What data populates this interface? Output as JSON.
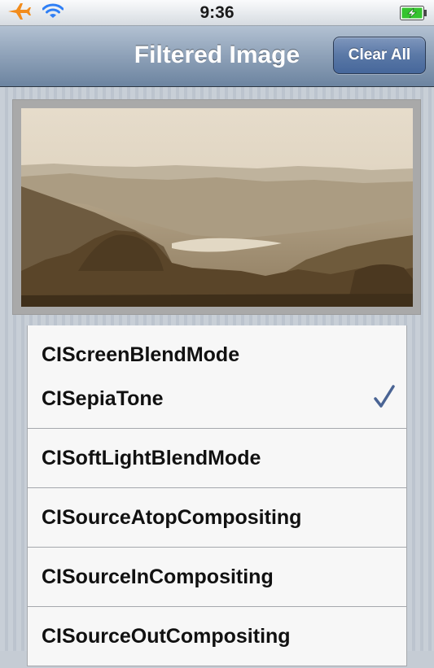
{
  "status_bar": {
    "time": "9:36",
    "icons": [
      "airplane-icon",
      "wifi-icon",
      "battery-charging-icon"
    ],
    "airplane_color": "#f28c1c",
    "wifi_color": "#2f7ff5",
    "battery_color": "#35c42f"
  },
  "nav": {
    "title": "Filtered Image",
    "clear_button": "Clear All"
  },
  "image": {
    "filter_applied": "CISepiaTone"
  },
  "filters": [
    {
      "label": "CIScreenBlendMode",
      "selected": false
    },
    {
      "label": "CISepiaTone",
      "selected": true
    },
    {
      "label": "CISoftLightBlendMode",
      "selected": false
    },
    {
      "label": "CISourceAtopCompositing",
      "selected": false
    },
    {
      "label": "CISourceInCompositing",
      "selected": false
    },
    {
      "label": "CISourceOutCompositing",
      "selected": false
    }
  ],
  "colors": {
    "checkmark": "#4a6494",
    "nav_tint": "#7089a6"
  }
}
